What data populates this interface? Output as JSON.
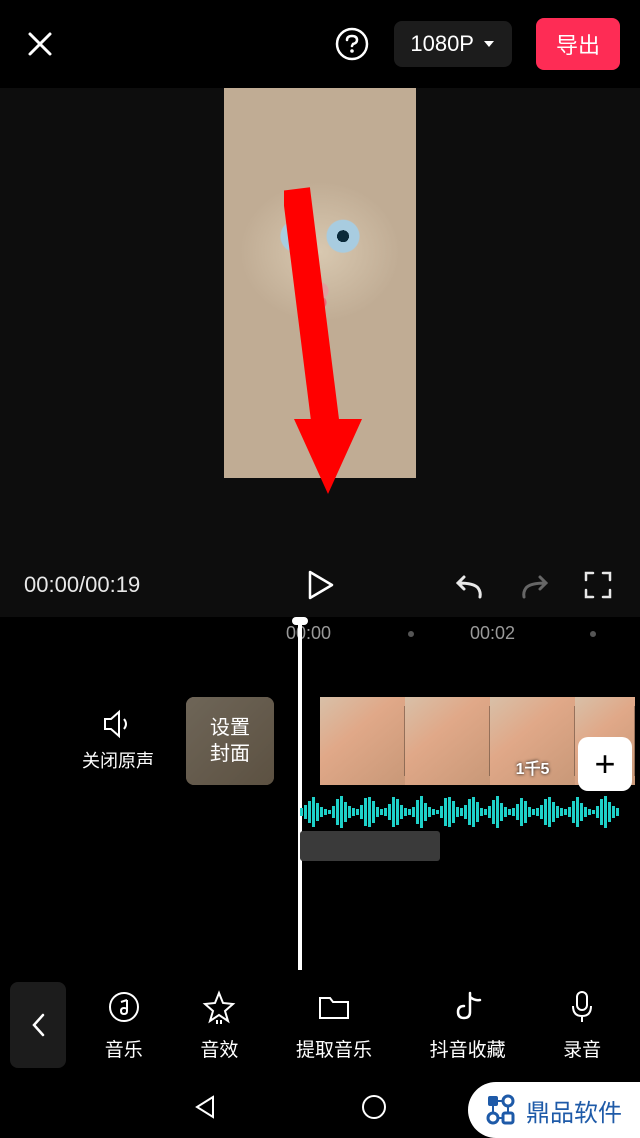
{
  "header": {
    "resolution_label": "1080P",
    "export_label": "导出"
  },
  "time": {
    "display": "00:00/00:19",
    "ruler": [
      "00:00",
      "00:02"
    ]
  },
  "timeline": {
    "mute_label": "关闭原声",
    "cover_label": "设置\n封面",
    "clip_overlay": "1千5"
  },
  "toolbar": {
    "items": [
      {
        "label": "音乐"
      },
      {
        "label": "音效"
      },
      {
        "label": "提取音乐"
      },
      {
        "label": "抖音收藏"
      },
      {
        "label": "录音"
      }
    ]
  },
  "watermark": {
    "text": "鼎品软件"
  }
}
